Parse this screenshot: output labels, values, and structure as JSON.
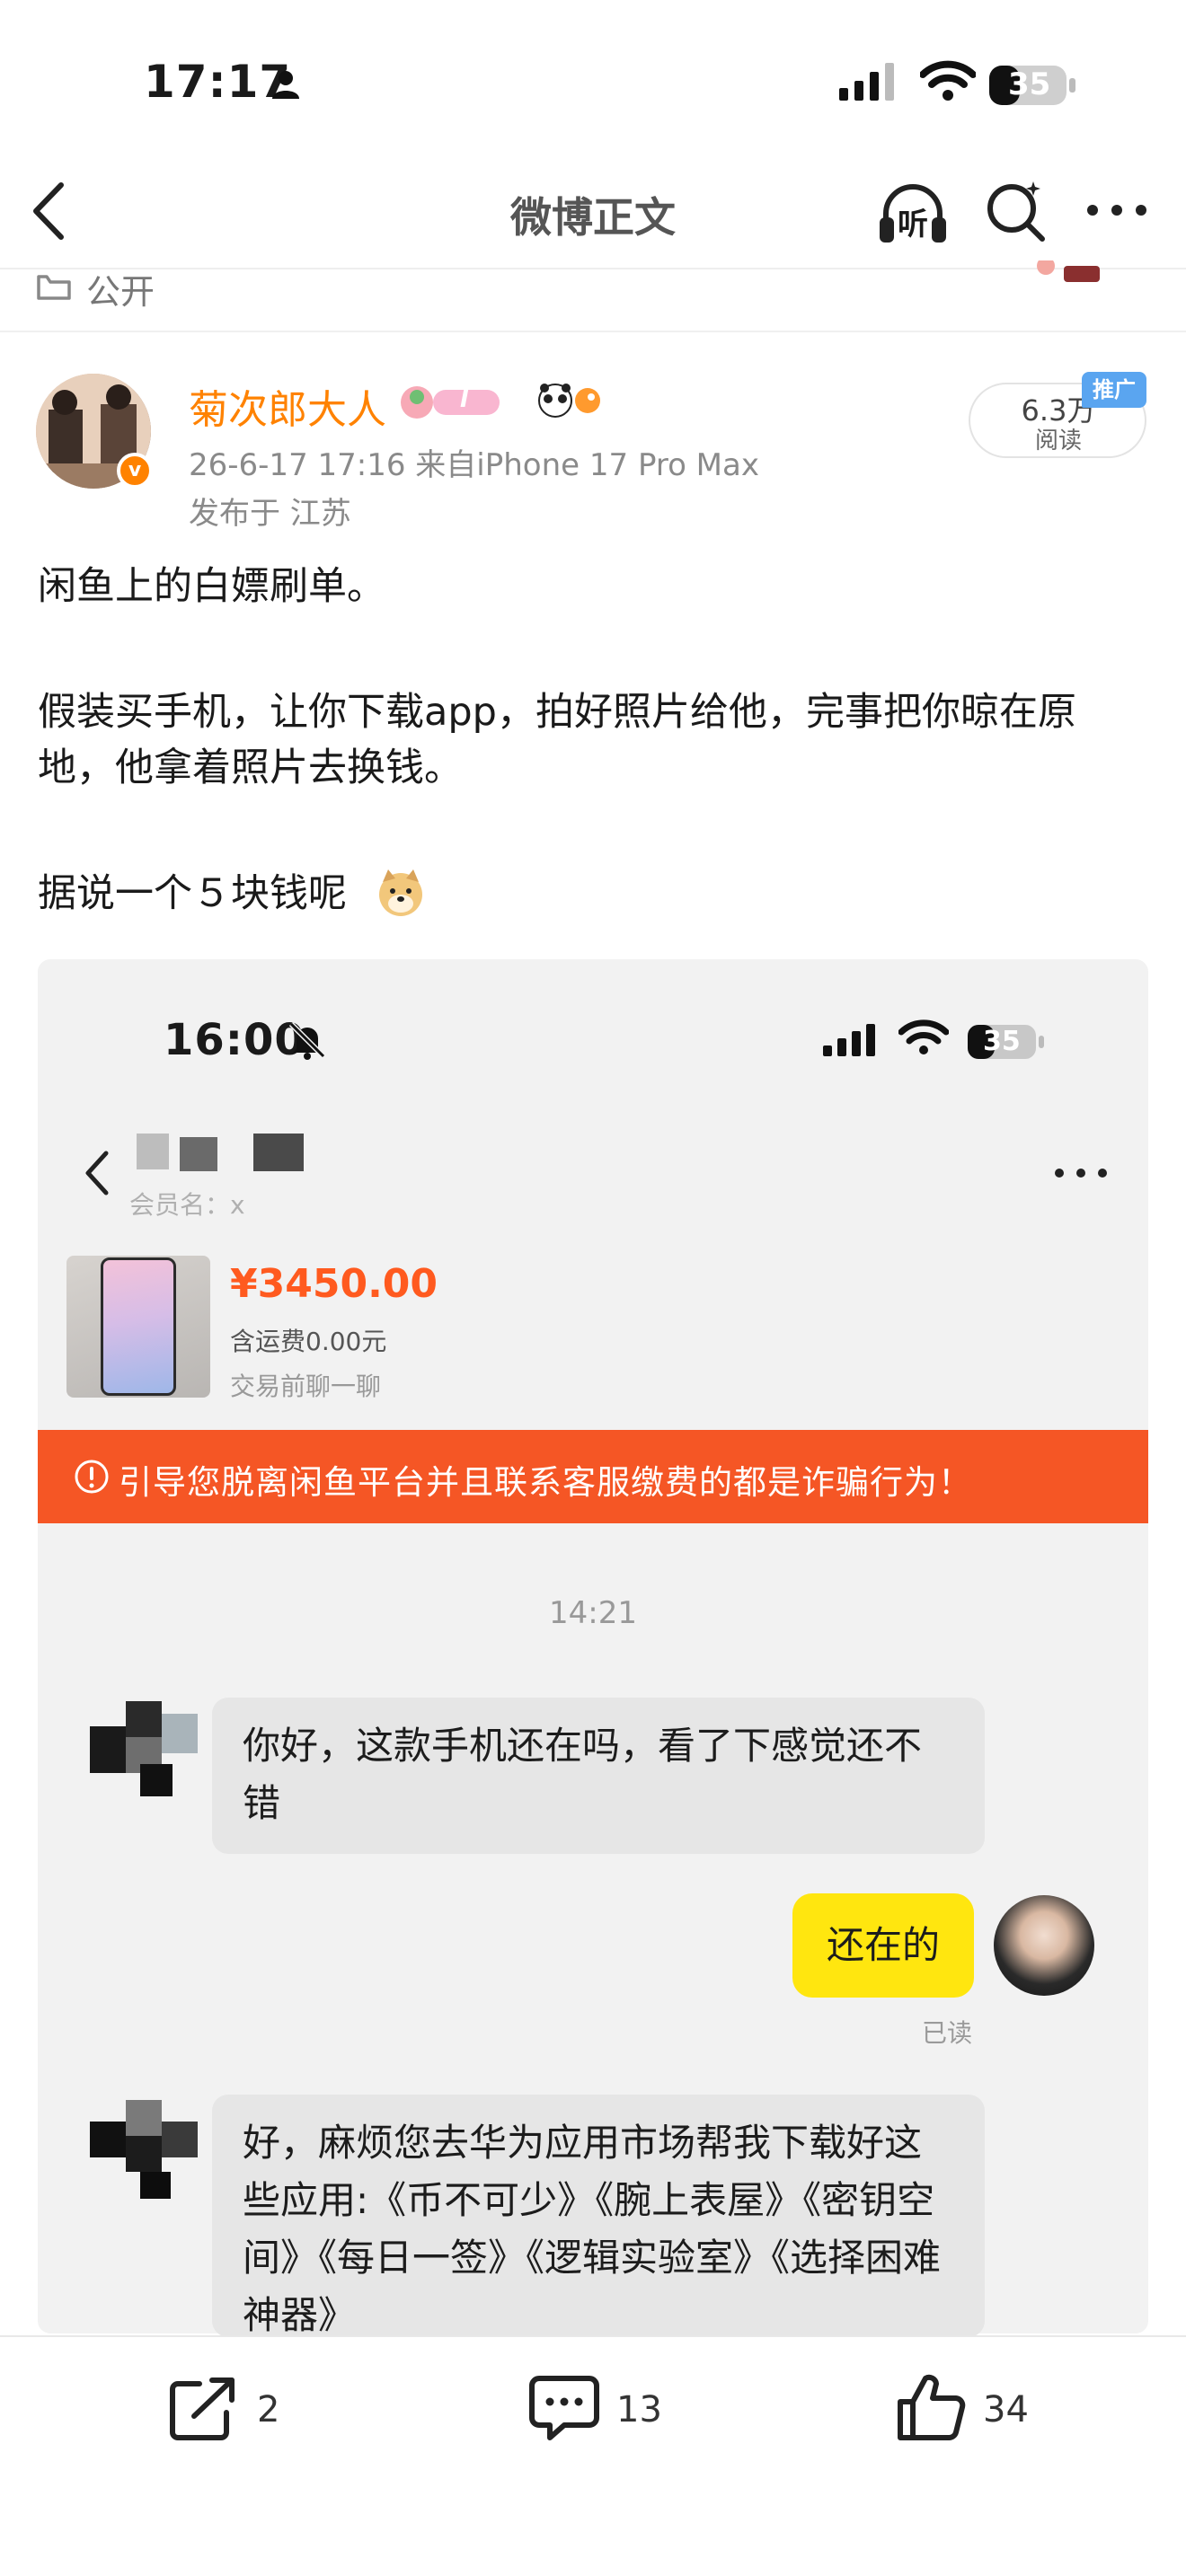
{
  "status_bar": {
    "time": "17:17",
    "battery": "35"
  },
  "nav": {
    "title": "微博正文",
    "listen_label": "听"
  },
  "visibility": {
    "label": "公开"
  },
  "author": {
    "name": "菊次郎大人",
    "verified_mark": "v",
    "level_badge": "I",
    "meta": "26-6-17 17:16 来自iPhone 17 Pro Max",
    "location": "发布于 江苏"
  },
  "reads": {
    "count": "6.3万",
    "label": "阅读",
    "promo_tag": "推广"
  },
  "post": {
    "line1": "闲鱼上的白嫖刷单。",
    "line2": "假装买手机，让你下载app，拍好照片给他，完事把你晾在原地，他拿着照片去换钱。",
    "line3": "据说一个５块钱呢"
  },
  "screenshot": {
    "status_time": "16:00",
    "battery": "35",
    "member_label": "会员名：x",
    "price": "¥3450.00",
    "shipping": "含运费0.00元",
    "chat_hint": "交易前聊一聊",
    "warning": "引导您脱离闲鱼平台并且联系客服缴费的都是诈骗行为！",
    "timestamp": "14:21",
    "msg1": "你好，这款手机还在吗，看了下感觉还不错",
    "msg2": "还在的",
    "read_status": "已读",
    "msg3": "好，麻烦您去华为应用市场帮我下载好这些应用:《币不可少》《腕上表屋》《密钥空间》《每日一签》《逻辑实验室》《选择困难神器》"
  },
  "toolbar": {
    "share_count": "2",
    "comment_count": "13",
    "like_count": "34"
  },
  "colors": {
    "brand_orange": "#ff8200",
    "price_red": "#ff5a1f",
    "warning_bg": "#f55625",
    "bubble_yellow": "#ffe60f"
  },
  "icons": [
    "person-icon",
    "signal-icon",
    "wifi-icon",
    "battery-icon",
    "back-icon",
    "listen-icon",
    "search-icon",
    "more-icon",
    "lock-icon",
    "doge-emoji-icon",
    "bell-off-icon",
    "warning-icon",
    "share-icon",
    "comment-icon",
    "like-icon"
  ]
}
